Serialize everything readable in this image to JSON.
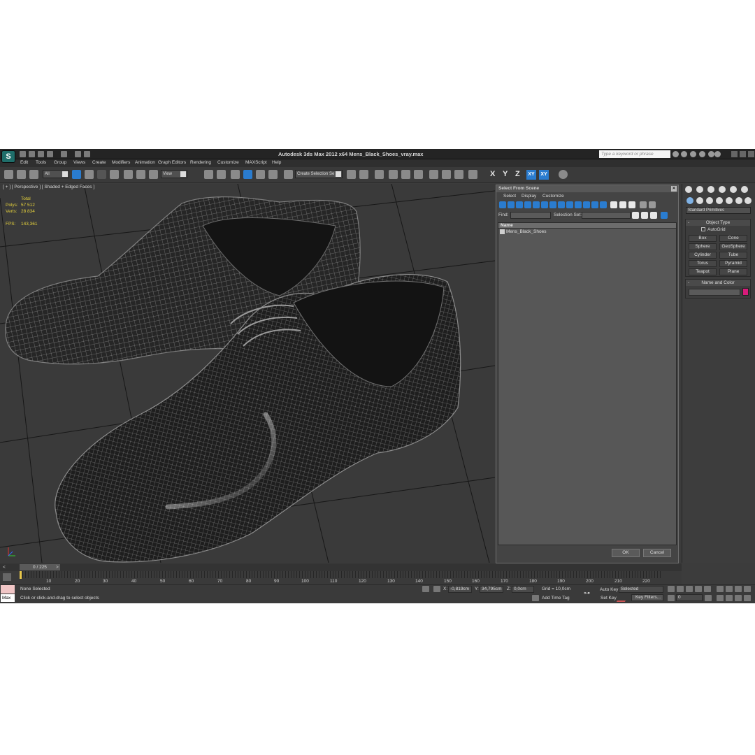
{
  "app": {
    "logo": "S",
    "title": "Autodesk 3ds Max  2012 x64     Mens_Black_Shoes_vray.max",
    "search_placeholder": "Type a keyword or phrase"
  },
  "menu": [
    "Edit",
    "Tools",
    "Group",
    "Views",
    "Create",
    "Modifiers",
    "Animation",
    "Graph Editors",
    "Rendering",
    "Customize",
    "MAXScript",
    "Help"
  ],
  "toolbar": {
    "filter": "All",
    "ref_coord": "View",
    "selection_set": "Create Selection Se",
    "axis": [
      "X",
      "Y",
      "Z",
      "XY",
      "XY"
    ]
  },
  "viewport": {
    "label": "[ + ] [ Perspective ] [ Shaded + Edged Faces ]",
    "stats": {
      "total": "Total",
      "polys_label": "Polys:",
      "polys": "57 512",
      "verts_label": "Verts:",
      "verts": "28 834",
      "fps_label": "FPS:",
      "fps": "143,361"
    }
  },
  "dialog": {
    "title": "Select From Scene",
    "menu": [
      "Select",
      "Display",
      "Customize"
    ],
    "find_label": "Find:",
    "selection_set_label": "Selection Set:",
    "list_header": "Name",
    "items": [
      "Mens_Black_Shoes"
    ],
    "ok": "OK",
    "cancel": "Cancel"
  },
  "command_panel": {
    "category": "Standard Primitives",
    "object_type_header": "Object Type",
    "autogrid": "AutoGrid",
    "primitives": [
      "Box",
      "Cone",
      "Sphere",
      "GeoSphere",
      "Cylinder",
      "Tube",
      "Torus",
      "Pyramid",
      "Teapot",
      "Plane"
    ],
    "name_color_header": "Name and Color",
    "object_color": "#d81b7a"
  },
  "timeline": {
    "frame": "0 / 225",
    "ticks": [
      "10",
      "20",
      "30",
      "40",
      "50",
      "60",
      "70",
      "80",
      "90",
      "100",
      "110",
      "120",
      "130",
      "140",
      "150",
      "160",
      "170",
      "180",
      "190",
      "200",
      "210",
      "220"
    ]
  },
  "status": {
    "script_label": "Max",
    "none_selected": "None Selected",
    "prompt": "Click or click-and-drag to select objects",
    "x_label": "X:",
    "x": "-0,819cm",
    "y_label": "Y:",
    "y": "34,795cm",
    "z_label": "Z:",
    "z": "0,0cm",
    "grid": "Grid = 10,0cm",
    "add_time_tag": "Add Time Tag",
    "auto_key": "Auto Key",
    "selected": "Selected",
    "set_key": "Set Key",
    "key_filters": "Key Filters...",
    "current_frame": "0"
  }
}
